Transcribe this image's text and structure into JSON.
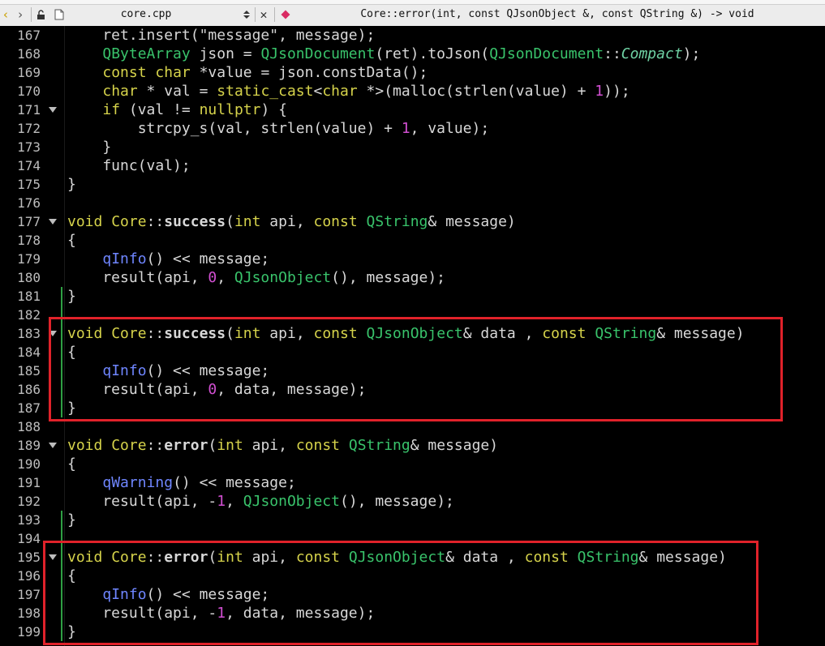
{
  "toolbar": {
    "file_name": "core.cpp",
    "symbol": "Core::error(int, const QJsonObject &, const QString &) -> void",
    "icons": {
      "back": "chevron-left-icon",
      "forward": "chevron-right-icon",
      "lock": "lock-icon",
      "file": "file-icon",
      "combo": "combo-arrows-icon",
      "close": "close-icon",
      "symbol": "symbol-icon"
    }
  },
  "colors": {
    "background": "#000000",
    "keyword": "#d6d34b",
    "type": "#39c36b",
    "function_call": "#6f86ff",
    "number": "#d14fd1",
    "annotation": "#e0222a",
    "diff_marker": "#2ea043"
  },
  "editor": {
    "lines": [
      {
        "num": "167",
        "fold": false,
        "diff": false,
        "tokens": [
          [
            "    ret.insert(",
            ""
          ],
          [
            "\"message\"",
            "str"
          ],
          [
            ", message);",
            ""
          ]
        ]
      },
      {
        "num": "168",
        "fold": false,
        "diff": false,
        "tokens": [
          [
            "    ",
            ""
          ],
          [
            "QByteArray",
            "ty"
          ],
          [
            " json = ",
            ""
          ],
          [
            "QJsonDocument",
            "ty"
          ],
          [
            "(ret).toJson(",
            ""
          ],
          [
            "QJsonDocument",
            "ty"
          ],
          [
            "::",
            ""
          ],
          [
            "Compact",
            "it"
          ],
          [
            ");",
            ""
          ]
        ]
      },
      {
        "num": "169",
        "fold": false,
        "diff": false,
        "tokens": [
          [
            "    ",
            ""
          ],
          [
            "const",
            "kw"
          ],
          [
            " ",
            ""
          ],
          [
            "char",
            "kw"
          ],
          [
            " *value = json.constData();",
            ""
          ]
        ]
      },
      {
        "num": "170",
        "fold": false,
        "diff": false,
        "tokens": [
          [
            "    ",
            ""
          ],
          [
            "char",
            "kw"
          ],
          [
            " * val = ",
            ""
          ],
          [
            "static_cast",
            "kw"
          ],
          [
            "<",
            ""
          ],
          [
            "char",
            "kw"
          ],
          [
            " *>(malloc(strlen(value) + ",
            ""
          ],
          [
            "1",
            "num"
          ],
          [
            "));",
            ""
          ]
        ]
      },
      {
        "num": "171",
        "fold": true,
        "diff": false,
        "tokens": [
          [
            "    ",
            ""
          ],
          [
            "if",
            "kw"
          ],
          [
            " (val != ",
            ""
          ],
          [
            "nullptr",
            "kw"
          ],
          [
            ") {",
            ""
          ]
        ]
      },
      {
        "num": "172",
        "fold": false,
        "diff": false,
        "tokens": [
          [
            "        strcpy_s(val, strlen(value) + ",
            ""
          ],
          [
            "1",
            "num"
          ],
          [
            ", value);",
            ""
          ]
        ]
      },
      {
        "num": "173",
        "fold": false,
        "diff": false,
        "tokens": [
          [
            "    }",
            ""
          ]
        ]
      },
      {
        "num": "174",
        "fold": false,
        "diff": false,
        "tokens": [
          [
            "    func(val);",
            ""
          ]
        ]
      },
      {
        "num": "175",
        "fold": false,
        "diff": false,
        "tokens": [
          [
            "}",
            ""
          ]
        ]
      },
      {
        "num": "176",
        "fold": false,
        "diff": false,
        "tokens": []
      },
      {
        "num": "177",
        "fold": true,
        "diff": false,
        "tokens": [
          [
            "void",
            "kw"
          ],
          [
            " ",
            ""
          ],
          [
            "Core",
            "cls"
          ],
          [
            "::",
            ""
          ],
          [
            "success",
            "fn"
          ],
          [
            "(",
            ""
          ],
          [
            "int",
            "kw"
          ],
          [
            " api, ",
            ""
          ],
          [
            "const",
            "kw"
          ],
          [
            " ",
            ""
          ],
          [
            "QString",
            "ty"
          ],
          [
            "& message)",
            ""
          ]
        ]
      },
      {
        "num": "178",
        "fold": false,
        "diff": false,
        "tokens": [
          [
            "{",
            ""
          ]
        ]
      },
      {
        "num": "179",
        "fold": false,
        "diff": false,
        "tokens": [
          [
            "    ",
            ""
          ],
          [
            "qInfo",
            "fq"
          ],
          [
            "() << message;",
            ""
          ]
        ]
      },
      {
        "num": "180",
        "fold": false,
        "diff": false,
        "tokens": [
          [
            "    result(api, ",
            ""
          ],
          [
            "0",
            "num"
          ],
          [
            ", ",
            ""
          ],
          [
            "QJsonObject",
            "ty"
          ],
          [
            "(), message);",
            ""
          ]
        ]
      },
      {
        "num": "181",
        "fold": false,
        "diff": true,
        "tokens": [
          [
            "}",
            ""
          ]
        ]
      },
      {
        "num": "182",
        "fold": false,
        "diff": true,
        "tokens": []
      },
      {
        "num": "183",
        "fold": true,
        "diff": true,
        "tokens": [
          [
            "void",
            "kw"
          ],
          [
            " ",
            ""
          ],
          [
            "Core",
            "cls"
          ],
          [
            "::",
            ""
          ],
          [
            "success",
            "fn"
          ],
          [
            "(",
            ""
          ],
          [
            "int",
            "kw"
          ],
          [
            " api, ",
            ""
          ],
          [
            "const",
            "kw"
          ],
          [
            " ",
            ""
          ],
          [
            "QJsonObject",
            "ty"
          ],
          [
            "& data , ",
            ""
          ],
          [
            "const",
            "kw"
          ],
          [
            " ",
            ""
          ],
          [
            "QString",
            "ty"
          ],
          [
            "& message)",
            ""
          ]
        ]
      },
      {
        "num": "184",
        "fold": false,
        "diff": true,
        "tokens": [
          [
            "{",
            ""
          ]
        ]
      },
      {
        "num": "185",
        "fold": false,
        "diff": true,
        "tokens": [
          [
            "    ",
            ""
          ],
          [
            "qInfo",
            "fq"
          ],
          [
            "() << message;",
            ""
          ]
        ]
      },
      {
        "num": "186",
        "fold": false,
        "diff": true,
        "tokens": [
          [
            "    result(api, ",
            ""
          ],
          [
            "0",
            "num"
          ],
          [
            ", data, message);",
            ""
          ]
        ]
      },
      {
        "num": "187",
        "fold": false,
        "diff": true,
        "tokens": [
          [
            "}",
            ""
          ]
        ]
      },
      {
        "num": "188",
        "fold": false,
        "diff": false,
        "tokens": []
      },
      {
        "num": "189",
        "fold": true,
        "diff": false,
        "tokens": [
          [
            "void",
            "kw"
          ],
          [
            " ",
            ""
          ],
          [
            "Core",
            "cls"
          ],
          [
            "::",
            ""
          ],
          [
            "error",
            "fn"
          ],
          [
            "(",
            ""
          ],
          [
            "int",
            "kw"
          ],
          [
            " api, ",
            ""
          ],
          [
            "const",
            "kw"
          ],
          [
            " ",
            ""
          ],
          [
            "QString",
            "ty"
          ],
          [
            "& message)",
            ""
          ]
        ]
      },
      {
        "num": "190",
        "fold": false,
        "diff": false,
        "tokens": [
          [
            "{",
            ""
          ]
        ]
      },
      {
        "num": "191",
        "fold": false,
        "diff": false,
        "tokens": [
          [
            "    ",
            ""
          ],
          [
            "qWarning",
            "fq"
          ],
          [
            "() << message;",
            ""
          ]
        ]
      },
      {
        "num": "192",
        "fold": false,
        "diff": false,
        "tokens": [
          [
            "    result(api, -",
            ""
          ],
          [
            "1",
            "num"
          ],
          [
            ", ",
            ""
          ],
          [
            "QJsonObject",
            "ty"
          ],
          [
            "(), message);",
            ""
          ]
        ]
      },
      {
        "num": "193",
        "fold": false,
        "diff": true,
        "tokens": [
          [
            "}",
            ""
          ]
        ]
      },
      {
        "num": "194",
        "fold": false,
        "diff": true,
        "tokens": []
      },
      {
        "num": "195",
        "fold": true,
        "diff": true,
        "tokens": [
          [
            "void",
            "kw"
          ],
          [
            " ",
            ""
          ],
          [
            "Core",
            "cls"
          ],
          [
            "::",
            ""
          ],
          [
            "error",
            "fn"
          ],
          [
            "(",
            ""
          ],
          [
            "int",
            "kw"
          ],
          [
            " api, ",
            ""
          ],
          [
            "const",
            "kw"
          ],
          [
            " ",
            ""
          ],
          [
            "QJsonObject",
            "ty"
          ],
          [
            "& data , ",
            ""
          ],
          [
            "const",
            "kw"
          ],
          [
            " ",
            ""
          ],
          [
            "QString",
            "ty"
          ],
          [
            "& message)",
            ""
          ]
        ]
      },
      {
        "num": "196",
        "fold": false,
        "diff": true,
        "tokens": [
          [
            "{",
            ""
          ]
        ]
      },
      {
        "num": "197",
        "fold": false,
        "diff": true,
        "tokens": [
          [
            "    ",
            ""
          ],
          [
            "qInfo",
            "fq"
          ],
          [
            "() << message;",
            ""
          ]
        ]
      },
      {
        "num": "198",
        "fold": false,
        "diff": true,
        "tokens": [
          [
            "    result(api, -",
            ""
          ],
          [
            "1",
            "num"
          ],
          [
            ", data, message);",
            ""
          ]
        ]
      },
      {
        "num": "199",
        "fold": false,
        "diff": true,
        "tokens": [
          [
            "}",
            ""
          ]
        ]
      }
    ],
    "highlights": [
      {
        "name": "highlight-box-success-overload",
        "first_line": "183",
        "last_line": "187"
      },
      {
        "name": "highlight-box-error-overload",
        "first_line": "195",
        "last_line": "199"
      }
    ]
  }
}
